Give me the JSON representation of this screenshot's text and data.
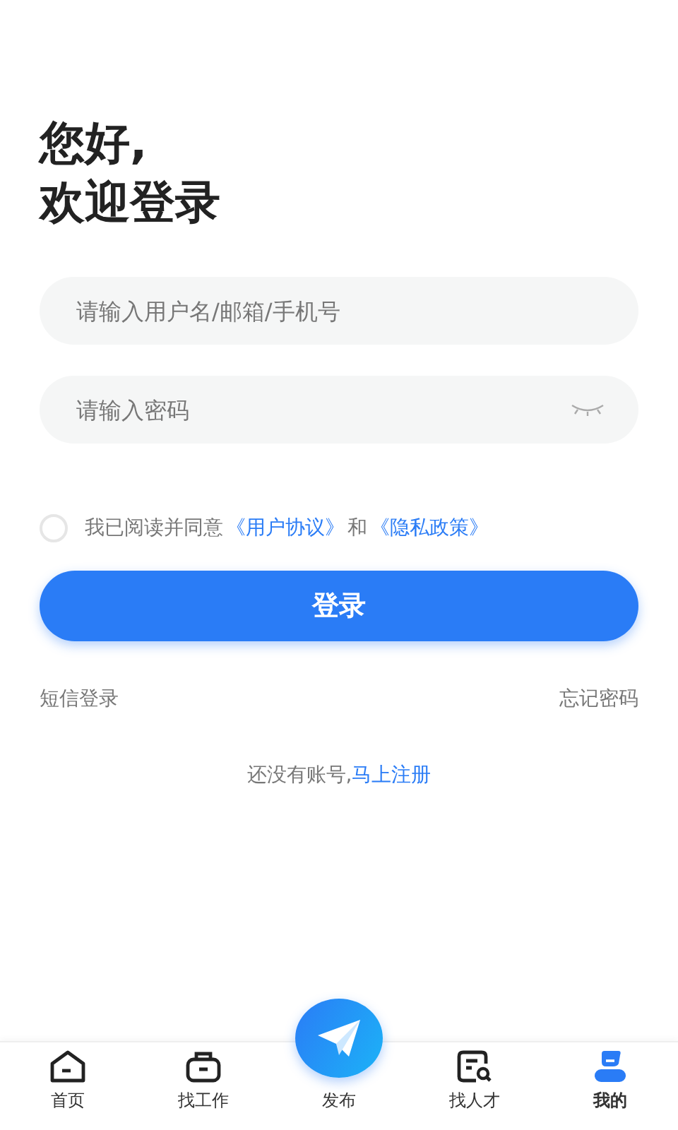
{
  "greeting": [
    "您好,",
    "欢迎登录"
  ],
  "fields": [
    {
      "placeholder": "请输入用户名/邮箱/手机号",
      "kind": "text"
    },
    {
      "placeholder": "请输入密码",
      "kind": "password"
    }
  ],
  "agreement": {
    "checked": false,
    "text": "我已阅读并同意",
    "link1": "《用户协议》",
    "joiner": "和",
    "link2": "《隐私政策》"
  },
  "login_button": "登录",
  "links": {
    "sms": "短信登录",
    "forgot": "忘记密码"
  },
  "register": {
    "text": "还没有账号,",
    "link": "马上注册"
  },
  "tabs": [
    {
      "label": "首页",
      "kind": "home",
      "selected": false
    },
    {
      "label": "找工作",
      "kind": "briefcase",
      "selected": false
    },
    {
      "label": "发布",
      "kind": "post",
      "selected": false
    },
    {
      "label": "找人才",
      "kind": "search-doc",
      "selected": false
    },
    {
      "label": "我的",
      "kind": "user",
      "selected": true
    }
  ]
}
